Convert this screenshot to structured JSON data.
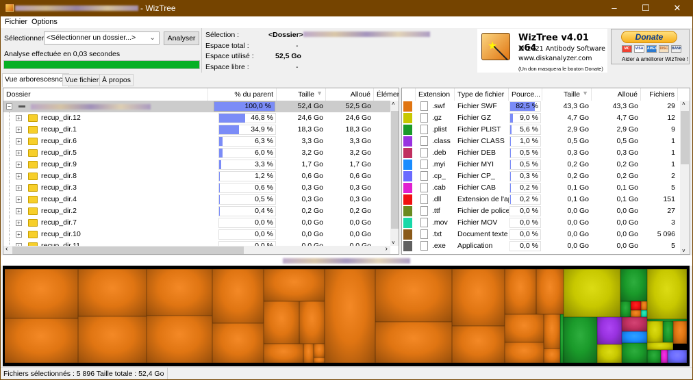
{
  "window": {
    "title_suffix": "- WizTree",
    "minimize": "–",
    "maximize": "☐",
    "close": "✕"
  },
  "menu": [
    "Fichier",
    "Options"
  ],
  "toolbar": {
    "select_label": "Sélectionner :",
    "combo_value": "<Sélectionner un dossier...>",
    "analyse_button": "Analyser",
    "status": "Analyse effectuée en 0,03 secondes",
    "progress_percent": 100
  },
  "info": {
    "selection_label": "Sélection :",
    "selection_value": "<Dossier>",
    "total_label": "Espace total :",
    "total_value": "-",
    "used_label": "Espace utilisé :",
    "used_value": "52,5 Go",
    "free_label": "Espace libre :",
    "free_value": "-"
  },
  "about": {
    "product": "WizTree v4.01 x64",
    "copyright": "© 2021 Antibody Software",
    "website": "www.diskanalyzer.com",
    "note": "(Un don masquera le bouton Donate)",
    "donate_button": "Donate",
    "donate_caption": "Aider à améliorer WizTree !",
    "cards": [
      "MC",
      "VISA",
      "AMEX",
      "DISC",
      "BANK"
    ]
  },
  "tabs": [
    {
      "label": "Vue arborescesnce",
      "active": true
    },
    {
      "label": "Vue fichier",
      "active": false
    },
    {
      "label": "À propos",
      "active": false
    }
  ],
  "tree": {
    "columns": [
      "Dossier",
      "% du parent",
      "Taille",
      "Alloué",
      "Élémen"
    ],
    "sort_column": "Taille",
    "root": {
      "percent": "100,0 %",
      "pct": 100,
      "size": "52,4 Go",
      "alloc": "52,5 Go"
    },
    "rows": [
      {
        "name": "recup_dir.12",
        "percent": "46,8 %",
        "pct": 46.8,
        "size": "24,6 Go",
        "alloc": "24,6 Go"
      },
      {
        "name": "recup_dir.1",
        "percent": "34,9 %",
        "pct": 34.9,
        "size": "18,3 Go",
        "alloc": "18,3 Go"
      },
      {
        "name": "recup_dir.6",
        "percent": "6,3 %",
        "pct": 6.3,
        "size": "3,3 Go",
        "alloc": "3,3 Go"
      },
      {
        "name": "recup_dir.5",
        "percent": "6,0 %",
        "pct": 6.0,
        "size": "3,2 Go",
        "alloc": "3,2 Go"
      },
      {
        "name": "recup_dir.9",
        "percent": "3,3 %",
        "pct": 3.3,
        "size": "1,7 Go",
        "alloc": "1,7 Go"
      },
      {
        "name": "recup_dir.8",
        "percent": "1,2 %",
        "pct": 1.2,
        "size": "0,6 Go",
        "alloc": "0,6 Go"
      },
      {
        "name": "recup_dir.3",
        "percent": "0,6 %",
        "pct": 0.6,
        "size": "0,3 Go",
        "alloc": "0,3 Go"
      },
      {
        "name": "recup_dir.4",
        "percent": "0,5 %",
        "pct": 0.5,
        "size": "0,3 Go",
        "alloc": "0,3 Go"
      },
      {
        "name": "recup_dir.2",
        "percent": "0,4 %",
        "pct": 0.4,
        "size": "0,2 Go",
        "alloc": "0,2 Go"
      },
      {
        "name": "recup_dir.7",
        "percent": "0,0 %",
        "pct": 0,
        "size": "0,0 Go",
        "alloc": "0,0 Go"
      },
      {
        "name": "recup_dir.10",
        "percent": "0,0 %",
        "pct": 0,
        "size": "0,0 Go",
        "alloc": "0,0 Go"
      },
      {
        "name": "recup_dir.11",
        "percent": "0,0 %",
        "pct": 0,
        "size": "0,0 Go",
        "alloc": "0,0 Go"
      }
    ]
  },
  "filetypes": {
    "columns": [
      "Extension",
      "Type de fichier",
      "Pource...",
      "Taille",
      "Alloué",
      "Fichiers"
    ],
    "sort_column": "Taille",
    "rows": [
      {
        "color": "#e07512",
        "ext": ".swf",
        "type": "Fichier SWF",
        "percent": "82,5 %",
        "pct": 82.5,
        "size": "43,3 Go",
        "alloc": "43,3 Go",
        "files": "29"
      },
      {
        "color": "#c8c800",
        "ext": ".gz",
        "type": "Fichier GZ",
        "percent": "9,0 %",
        "pct": 9.0,
        "size": "4,7 Go",
        "alloc": "4,7 Go",
        "files": "12"
      },
      {
        "color": "#1a9a2a",
        "ext": ".plist",
        "type": "Fichier PLIST",
        "percent": "5,6 %",
        "pct": 5.6,
        "size": "2,9 Go",
        "alloc": "2,9 Go",
        "files": "9"
      },
      {
        "color": "#9932e0",
        "ext": ".class",
        "type": "Fichier CLASS",
        "percent": "1,0 %",
        "pct": 1.0,
        "size": "0,5 Go",
        "alloc": "0,5 Go",
        "files": "1"
      },
      {
        "color": "#c03060",
        "ext": ".deb",
        "type": "Fichier DEB",
        "percent": "0,5 %",
        "pct": 0.5,
        "size": "0,3 Go",
        "alloc": "0,3 Go",
        "files": "1"
      },
      {
        "color": "#1a8cff",
        "ext": ".myi",
        "type": "Fichier MYI",
        "percent": "0,5 %",
        "pct": 0.5,
        "size": "0,2 Go",
        "alloc": "0,2 Go",
        "files": "1"
      },
      {
        "color": "#6a6aff",
        "ext": ".cp_",
        "type": "Fichier CP_",
        "percent": "0,3 %",
        "pct": 0.3,
        "size": "0,2 Go",
        "alloc": "0,2 Go",
        "files": "2"
      },
      {
        "color": "#e020d0",
        "ext": ".cab",
        "type": "Fichier CAB",
        "percent": "0,2 %",
        "pct": 0.2,
        "size": "0,1 Go",
        "alloc": "0,1 Go",
        "files": "5"
      },
      {
        "color": "#f01010",
        "ext": ".dll",
        "type": "Extension de l'ap",
        "percent": "0,2 %",
        "pct": 0.2,
        "size": "0,1 Go",
        "alloc": "0,1 Go",
        "files": "151"
      },
      {
        "color": "#6a8a20",
        "ext": ".ttf",
        "type": "Fichier de police",
        "percent": "0,0 %",
        "pct": 0,
        "size": "0,0 Go",
        "alloc": "0,0 Go",
        "files": "27"
      },
      {
        "color": "#18d8a8",
        "ext": ".mov",
        "type": "Fichier MOV",
        "percent": "0,0 %",
        "pct": 0,
        "size": "0,0 Go",
        "alloc": "0,0 Go",
        "files": "3"
      },
      {
        "color": "#8a5a1a",
        "ext": ".txt",
        "type": "Document texte",
        "percent": "0,0 %",
        "pct": 0,
        "size": "0,0 Go",
        "alloc": "0,0 Go",
        "files": "5 096"
      },
      {
        "color": "#606060",
        "ext": ".exe",
        "type": "Application",
        "percent": "0,0 %",
        "pct": 0,
        "size": "0,0 Go",
        "alloc": "0,0 Go",
        "files": "5"
      }
    ]
  },
  "status": {
    "text": "Fichiers sélectionnés : 5 896  Taille totale : 52,4 Go"
  }
}
